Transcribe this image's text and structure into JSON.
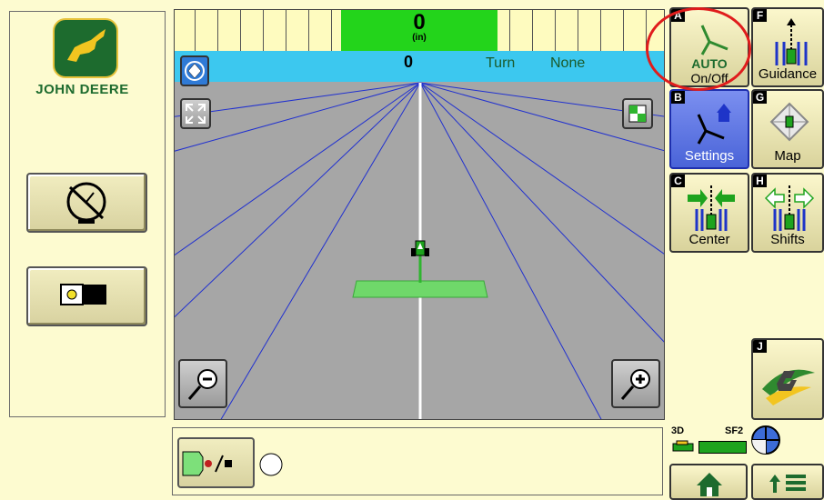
{
  "brand": {
    "name": "JOHN DEERE"
  },
  "header": {
    "offset_value": "0",
    "offset_unit": "(in)",
    "info_value": "0",
    "turn_label": "Turn",
    "turn_value": "None"
  },
  "right_buttons": [
    {
      "key": "A",
      "line1": "AUTO",
      "line2": "On/Off",
      "icon": "steering-wheel-icon"
    },
    {
      "key": "F",
      "label": "Guidance",
      "icon": "guidance-icon"
    },
    {
      "key": "B",
      "label": "Settings",
      "icon": "settings-icon"
    },
    {
      "key": "G",
      "label": "Map",
      "icon": "map-icon"
    },
    {
      "key": "C",
      "label": "Center",
      "icon": "center-icon"
    },
    {
      "key": "H",
      "label": "Shifts",
      "icon": "shifts-icon"
    },
    {
      "key": "J",
      "label": "",
      "icon": "gs2-icon"
    }
  ],
  "status": {
    "mode": "3D",
    "correction": "SF2"
  },
  "colors": {
    "accent_green": "#23d41b",
    "info_blue": "#3cc8ef",
    "highlight_red": "#e01c1c",
    "jd_green": "#1d6b2e"
  }
}
